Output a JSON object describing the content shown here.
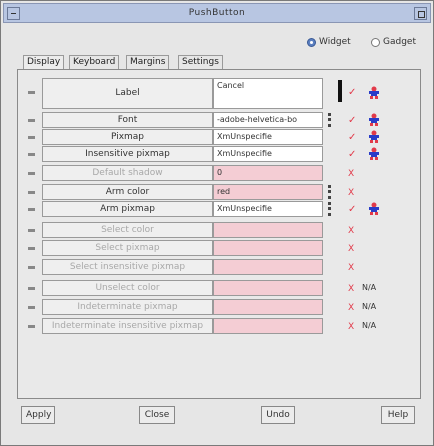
{
  "window": {
    "title": "PushButton"
  },
  "mode": {
    "widget_label": "Widget",
    "gadget_label": "Gadget",
    "selected": "Widget"
  },
  "tabs": [
    {
      "label": "Display"
    },
    {
      "label": "Keyboard"
    },
    {
      "label": "Margins"
    },
    {
      "label": "Settings"
    }
  ],
  "properties": [
    {
      "label": "Label",
      "value": "Cancel",
      "status": "✓",
      "dim": false
    },
    {
      "label": "Font",
      "value": "-adobe-helvetica-bo",
      "status": "✓",
      "dim": false
    },
    {
      "label": "Pixmap",
      "value": "XmUnspecifie",
      "status": "✓",
      "dim": false
    },
    {
      "label": "Insensitive pixmap",
      "value": "XmUnspecifie",
      "status": "✓",
      "dim": false
    },
    {
      "label": "Default shadow",
      "value": "0",
      "status": "X",
      "dim": true
    },
    {
      "label": "Arm color",
      "value": "red",
      "status": "X",
      "dim": false
    },
    {
      "label": "Arm pixmap",
      "value": "XmUnspecifie",
      "status": "✓",
      "dim": false
    },
    {
      "label": "Select color",
      "value": "",
      "status": "X",
      "dim": true
    },
    {
      "label": "Select pixmap",
      "value": "",
      "status": "X",
      "dim": true
    },
    {
      "label": "Select insensitive pixmap",
      "value": "",
      "status": "X",
      "dim": true
    },
    {
      "label": "Unselect color",
      "value": "",
      "status": "X",
      "na": "N/A",
      "dim": true
    },
    {
      "label": "Indeterminate pixmap",
      "value": "",
      "status": "X",
      "na": "N/A",
      "dim": true
    },
    {
      "label": "Indeterminate insensitive pixmap",
      "value": "",
      "status": "X",
      "na": "N/A",
      "dim": true
    }
  ],
  "actions": {
    "apply": "Apply",
    "close": "Close",
    "undo": "Undo",
    "help": "Help"
  },
  "colors": {
    "title_bg": "#b8c6e2",
    "pink_field": "#f4cdd4",
    "status": "#e23a4a"
  }
}
